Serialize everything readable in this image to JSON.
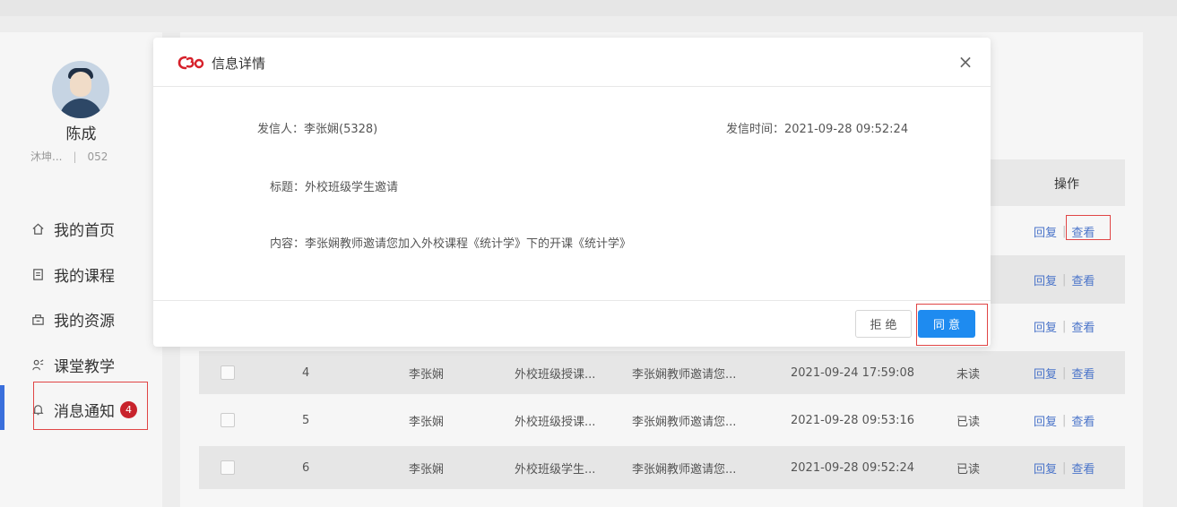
{
  "user": {
    "name": "陈成",
    "school": "沐坤...",
    "id_suffix": "052"
  },
  "nav": {
    "items": [
      {
        "label": "我的首页",
        "icon": "home-icon"
      },
      {
        "label": "我的课程",
        "icon": "document-icon"
      },
      {
        "label": "我的资源",
        "icon": "resource-icon"
      },
      {
        "label": "课堂教学",
        "icon": "teaching-icon"
      },
      {
        "label": "消息通知",
        "icon": "bell-icon",
        "badge": "4",
        "active": true
      }
    ]
  },
  "table": {
    "op_header": "操作",
    "reply_label": "回复",
    "view_label": "查看",
    "rows": [
      {
        "index": "4",
        "sender": "李张娴",
        "title": "外校班级授课...",
        "content": "李张娴教师邀请您...",
        "time": "2021-09-24 17:59:08",
        "status": "未读"
      },
      {
        "index": "5",
        "sender": "李张娴",
        "title": "外校班级授课...",
        "content": "李张娴教师邀请您...",
        "time": "2021-09-28 09:53:16",
        "status": "已读"
      },
      {
        "index": "6",
        "sender": "李张娴",
        "title": "外校班级学生...",
        "content": "李张娴教师邀请您...",
        "time": "2021-09-28 09:52:24",
        "status": "已读"
      }
    ]
  },
  "dialog": {
    "title": "信息详情",
    "close_symbol": "×",
    "sender_label": "发信人：",
    "sender_value": "李张娴(5328)",
    "time_label": "发信时间：",
    "time_value": "2021-09-28 09:52:24",
    "subject_label": "标题：",
    "subject_value": "外校班级学生邀请",
    "content_label": "内容：",
    "content_value": "李张娴教师邀请您加入外校课程《统计学》下的开课《统计学》",
    "reject_label": "拒绝",
    "agree_label": "同意"
  },
  "colors": {
    "accent": "#1e8bf0",
    "badge": "#c8232c",
    "highlight_box": "#e04545",
    "link": "#4a74c9"
  }
}
